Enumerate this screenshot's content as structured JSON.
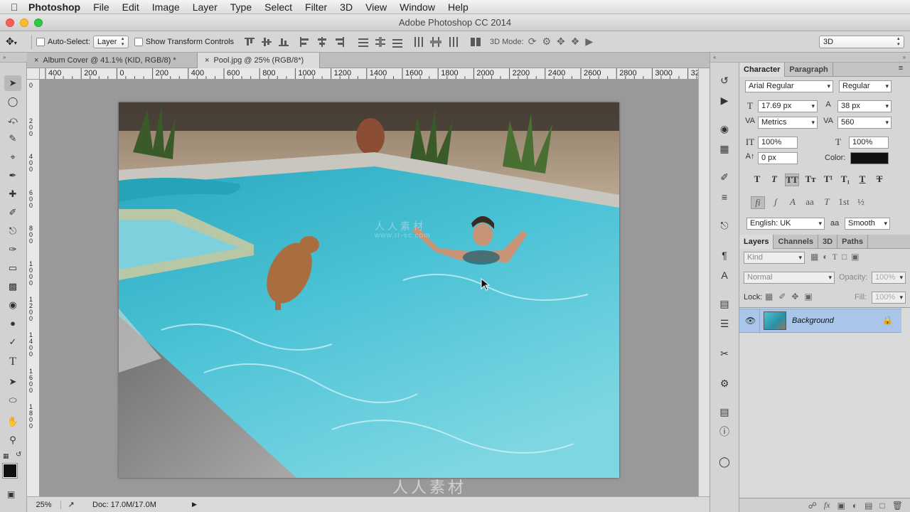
{
  "menubar": {
    "app_name": "Photoshop",
    "items": [
      "File",
      "Edit",
      "Image",
      "Layer",
      "Type",
      "Select",
      "Filter",
      "3D",
      "View",
      "Window",
      "Help"
    ]
  },
  "window": {
    "title": "Adobe Photoshop CC 2014"
  },
  "options": {
    "auto_select_label": "Auto-Select:",
    "auto_select_value": "Layer",
    "show_transform_label": "Show Transform Controls",
    "mode_label": "3D Mode:",
    "workspace_value": "3D"
  },
  "doc_tabs": [
    {
      "label": "Album Cover @ 41.1% (KID, RGB/8) *",
      "active": false
    },
    {
      "label": "Pool.jpg @ 25% (RGB/8*)",
      "active": true
    }
  ],
  "ruler_top": [
    "400",
    "200",
    "0",
    "200",
    "400",
    "600",
    "800",
    "1000",
    "1200",
    "1400",
    "1600",
    "1800",
    "2000",
    "2200",
    "2400",
    "2600",
    "2800",
    "3000",
    "32"
  ],
  "ruler_left": [
    "0",
    "2 0 0",
    "4 0 0",
    "6 0 0",
    "8 0 0",
    "1 0 0 0",
    "1 2 0 0",
    "1 4 0 0",
    "1 6 0 0",
    "1 8 0 0"
  ],
  "status": {
    "zoom": "25%",
    "doc": "Doc: 17.0M/17.0M"
  },
  "character": {
    "tabs": [
      "Character",
      "Paragraph"
    ],
    "font_family": "Arial Regular",
    "font_style": "Regular",
    "size": "17.69 px",
    "leading": "38 px",
    "kerning": "Metrics",
    "tracking": "560",
    "vscale": "100%",
    "hscale": "100%",
    "baseline": "0 px",
    "color_label": "Color:",
    "language": "English: UK",
    "aa_label": "aa",
    "antialias": "Smooth"
  },
  "layers": {
    "tabs": [
      "Layers",
      "Channels",
      "3D",
      "Paths"
    ],
    "filter": "Kind",
    "blend": "Normal",
    "opacity_label": "Opacity:",
    "opacity": "100%",
    "lock_label": "Lock:",
    "fill_label": "Fill:",
    "fill": "100%",
    "items": [
      {
        "name": "Background",
        "visible": true,
        "locked": true
      }
    ]
  },
  "watermark": {
    "text": "人人素材",
    "url": "www.rr-sc.com"
  }
}
